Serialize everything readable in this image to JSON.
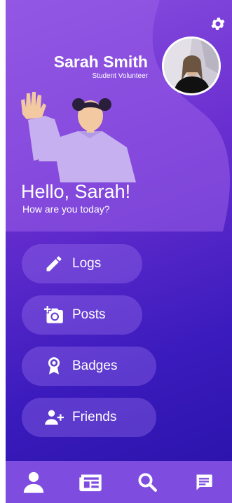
{
  "profile": {
    "name": "Sarah Smith",
    "role": "Student Volunteer"
  },
  "greeting": {
    "hello": "Hello, Sarah!",
    "question": "How are you today?"
  },
  "menu": [
    {
      "label": "Logs",
      "icon": "pencil-icon"
    },
    {
      "label": "Posts",
      "icon": "add-photo-icon"
    },
    {
      "label": "Badges",
      "icon": "badge-icon"
    },
    {
      "label": "Friends",
      "icon": "add-friend-icon"
    }
  ],
  "nav": [
    {
      "icon": "person-icon"
    },
    {
      "icon": "feed-icon"
    },
    {
      "icon": "search-icon"
    },
    {
      "icon": "chat-icon"
    }
  ],
  "colors": {
    "gradient_top": "#8a4fe0",
    "gradient_bottom": "#2812a8",
    "navbar": "#7e4de0",
    "button": "#9a78f0"
  }
}
